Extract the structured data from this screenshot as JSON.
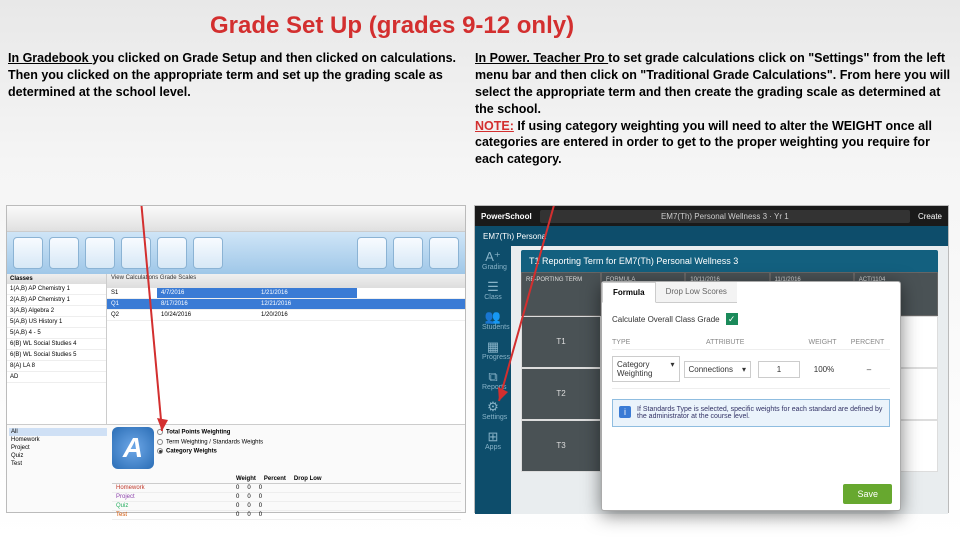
{
  "title": "Grade Set Up (grades 9-12 only)",
  "left": {
    "heading": "In Gradebook ",
    "text": "you clicked on Grade Setup and then clicked on calculations. Then you clicked on the appropriate term and set up the grading scale as determined at the school level."
  },
  "right": {
    "heading": "In Power. Teacher Pro ",
    "text": "to set grade calculations click on \"Settings\" from the left menu bar and then click on \"Traditional Grade Calculations\". From here you will select the appropriate term and then create the grading scale as determined at the school.",
    "note_label": "NOTE:",
    "note_text": " If using category weighting you will need to alter the WEIGHT once all categories are entered in order to get to the proper weighting you require for each category."
  },
  "gb": {
    "side_head": "Classes",
    "side_rows": [
      "1(A,B) AP Chemistry 1",
      "2(A,B) AP Chemistry 1",
      "3(A,B) Algebra 2",
      "5(A,B) US History 1",
      "5(A,B) 4 - 5",
      "6(B) WL Social Studies 4",
      "6(B) WL Social Studies 5",
      "8(A) LA 8",
      "AD"
    ],
    "tabs": "View    Calculations    Grade Scales",
    "rows": [
      {
        "a": "S1",
        "b": "4/7/2016",
        "c": "1/21/2016"
      },
      {
        "a": "Q1",
        "b": "8/17/2016",
        "c": "12/21/2016"
      },
      {
        "a": "Q2",
        "b": "10/24/2016",
        "c": "1/20/2016"
      }
    ],
    "bottom_opts": [
      "Total Points Weighting",
      "Term Weighting / Standards Weights",
      "Category Weights"
    ],
    "catg_head": [
      "",
      "Weight",
      "Percent",
      "Drop Low"
    ],
    "catg_rows": [
      [
        "Homework",
        "0",
        "0",
        "0"
      ],
      [
        "Project",
        "0",
        "0",
        "0"
      ],
      [
        "Quiz",
        "0",
        "0",
        "0"
      ],
      [
        "Test",
        "0",
        "0",
        "0"
      ]
    ],
    "tree": [
      "All",
      "Homework",
      "Project",
      "Quiz",
      "Test"
    ]
  },
  "pt": {
    "brand": "PowerSchool",
    "topnav": "EM7(Th) Personal Wellness 3 · Yr 1",
    "right_top": "Create",
    "subhead": "EM7(Th) Persona",
    "banner": "T1 Reporting Term for EM7(Th) Personal Wellness 3",
    "side_icons": [
      {
        "g": "A⁺",
        "l": "Grading"
      },
      {
        "g": "☰",
        "l": "Class"
      },
      {
        "g": "👥",
        "l": "Students"
      },
      {
        "g": "▦",
        "l": "Progress"
      },
      {
        "g": "⧉",
        "l": "Reports"
      },
      {
        "g": "⚙",
        "l": "Settings"
      },
      {
        "g": "⊞",
        "l": "Apps"
      }
    ],
    "hdr": [
      "RE-PORTING TERM",
      "FORMULA",
      "",
      "10/11/2016",
      "11/1/2016",
      "ACT/1104"
    ],
    "rows": [
      {
        "l": "T1",
        "cells": [
          "✓",
          "✓",
          "✓",
          "–"
        ]
      },
      {
        "l": "T2",
        "cells": [
          "–",
          "✓",
          "✓",
          "✎"
        ]
      },
      {
        "l": "T3",
        "cells": [
          "–",
          "✓",
          "✓",
          "✎"
        ]
      }
    ],
    "modal": {
      "tab1": "Formula",
      "tab2": "Drop Low Scores",
      "calc_label": "Calculate Overall Class Grade",
      "hdr": [
        "TYPE",
        "ATTRIBUTE",
        "WEIGHT",
        "PERCENT"
      ],
      "type_val": "Category Weighting",
      "attr_val": "Connections",
      "weight": "1",
      "percent": "100%",
      "info": "If Standards Type is selected, specific weights for each standard are defined by the administrator at the course level.",
      "save": "Save"
    }
  }
}
